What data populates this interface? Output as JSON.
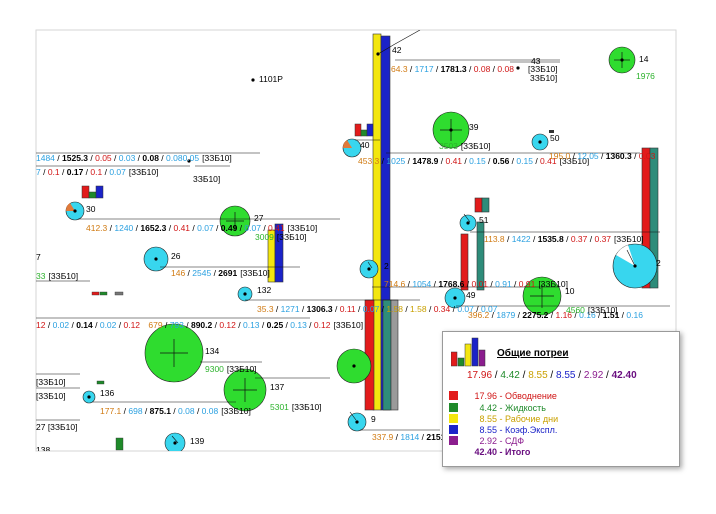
{
  "colors": {
    "red": "#e21b1b",
    "green": "#1f8a2a",
    "yellow": "#f3e60f",
    "blue": "#1b23c8",
    "purple": "#8b1d8e",
    "teal": "#2e8c7a",
    "cyan": "#38d6ee",
    "node_green": "#2fdc2f",
    "label_orange": "#d07a12",
    "label_blue": "#2aa0e0",
    "label_red": "#d01515",
    "label_green": "#2cb22c"
  },
  "nodes": {
    "n1101": "1101P",
    "n42": "42",
    "n43": "43",
    "n14": "14",
    "n39": "39",
    "n40": "40",
    "n50": "50",
    "n30": "30",
    "n27": "27",
    "n51": "51",
    "n26": "26",
    "n2": "2",
    "n132": "132",
    "n49": "49",
    "n10": "10",
    "n134": "134",
    "n136": "136",
    "n137": "137",
    "n139": "139",
    "n9": "9",
    "n7": "7",
    "n2r": "2",
    "n138": "138"
  },
  "labels": {
    "l43_tag": "3ЗБ10]",
    "l43_a": "64.3",
    "l43_b": "1717",
    "l43_c": "1781.3",
    "l43_d": "0.08",
    "l43_e": "0.08",
    "l43_f": "[3ЗБ10]",
    "l14_a": "1976",
    "l39_a": "3503",
    "l39_tag": "[3ЗБ10]",
    "l40_a": "453.3",
    "l40_b": "1025",
    "l40_c": "1478.9",
    "l40_d": "0.41",
    "l40_e": "0.15",
    "l40_f": "0.56",
    "l40_g": "0.15",
    "l40_h": "0.41",
    "l40_tag": "[3ЗБ10]",
    "l50_a": "195.0",
    "l50_b": "12.05",
    "l50_c": "1360.3",
    "l50_d": "0.03",
    "top_a": "1484",
    "top_b": "1525.3",
    "top_c": "0.05",
    "top_d": "0.03",
    "top_e": "0.08",
    "top_f": "0.08",
    "top_g": "0.05",
    "top_tag": "[3ЗБ10]",
    "top2_a": "7",
    "top2_b": "0.1",
    "top2_c": "0.17",
    "top2_d": "0.1",
    "top2_e": "0.07",
    "top2_tag": "[3ЗБ10]",
    "tag_3zb10": "3ЗБ10]",
    "l30_a": "412.3",
    "l30_b": "1240",
    "l30_c": "1652.3",
    "l30_d": "0.41",
    "l30_e": "0.07",
    "l30_f": "0.49",
    "l30_g": "0.07",
    "l30_h": "0.41",
    "l30_tag": "[3ЗБ10]",
    "l27_a": "3009",
    "l27_tag": "[3ЗБ10]",
    "l51_a": "113.8",
    "l51_b": "1422",
    "l51_c": "1535.8",
    "l51_d": "0.37",
    "l51_e": "0.37",
    "l51_tag": "[3ЗБ10]",
    "l26_a": "146",
    "l26_b": "2545",
    "l26_c": "2691",
    "l26_tag": "[3ЗБ10]",
    "l7_a": "33",
    "l7_tag": "[3ЗБ10]",
    "l2_a": "714.6",
    "l2_b": "1054",
    "l2_c": "1768.6",
    "l2_d": "0.01",
    "l2_e": "0.91",
    "l2_f": "0.91",
    "l2_tag": "[3ЗБ10]",
    "l132_a": "35.3",
    "l132_b": "1271",
    "l132_c": "1306.3",
    "l132_d": "0.11",
    "l132_e": "0.07",
    "l132_f": "1.58",
    "l132_g": "1.58",
    "l132_h": "0.34",
    "l132_i": "0.07",
    "l132_j": "0.07",
    "l49_a": "396.2",
    "l49_b": "1879",
    "l49_c": "2275.2",
    "l49_d": "1.16",
    "l49_e": "0.16",
    "l49_f": "1.51",
    "l49_g": "0.16",
    "l10_a": "4560",
    "l10_tag": "[3ЗБ10]",
    "row_a": "12",
    "row_b": "0.02",
    "row_c": "0.14",
    "row_d": "0.02",
    "row_e": "0.12",
    "row_f": "679",
    "row_g": "793",
    "row_h": "890.2",
    "row_i": "0.12",
    "row_j": "0.13",
    "row_k": "0.25",
    "row_l": "0.13",
    "row_m": "0.12",
    "row_tag": "[3ЗБ10]",
    "l134_a": "9300",
    "l134_tag": "[3ЗБ10]",
    "l136_tag1": "[3ЗБ10]",
    "l136_tag2": "[3ЗБ10]",
    "l136_a": "177.1",
    "l136_b": "698",
    "l136_c": "875.1",
    "l136_d": "0.08",
    "l136_e": "0.08",
    "l136_tag3": "[3ЗБ10]",
    "l137_a": "5301",
    "l137_tag": "[3ЗБ10]",
    "l27b_tag": "27 [3ЗБ10]",
    "l9_a": "337.9",
    "l9_b": "1814",
    "l9_c": "2151.9"
  },
  "legend": {
    "title": "Общие потреи",
    "sum": {
      "v1": "17.96",
      "v2": "4.42",
      "v3": "8.55",
      "v4": "8.55",
      "v5": "2.92",
      "v6": "42.40",
      "sep": " / "
    },
    "items": [
      {
        "value": "17.96",
        "label": " - Обводнение",
        "color": "#e21b1b",
        "text_color": "#d01515"
      },
      {
        "value": "4.42",
        "label": " - Жидкость",
        "color": "#1f8a2a",
        "text_color": "#1f8a2a"
      },
      {
        "value": "8.55",
        "label": " - Рабочие дни",
        "color": "#f3e60f",
        "text_color": "#c9a000"
      },
      {
        "value": "8.55",
        "label": " - Коэф.Экспл.",
        "color": "#1b23c8",
        "text_color": "#1b23c8"
      },
      {
        "value": "2.92",
        "label": " - СДФ",
        "color": "#8b1d8e",
        "text_color": "#8b1d8e"
      }
    ],
    "total": {
      "value": "42.40",
      "label": " - Итого"
    }
  }
}
